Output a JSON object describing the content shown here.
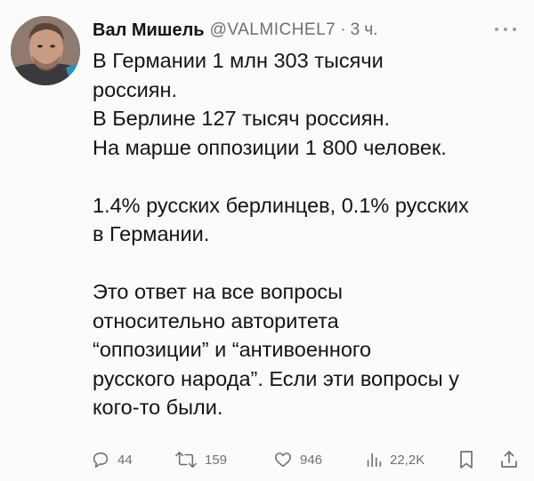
{
  "tweet": {
    "author_name": "Вал Мишель",
    "handle": "@VALMICHEL7",
    "separator": "·",
    "time": "3 ч.",
    "lines": [
      "В Германии 1 млн 303 тысячи",
      "россиян.",
      "В Берлине 127 тысяч россиян.",
      "На марше оппозиции 1 800 человек.",
      "",
      "1.4% русских берлинцев, 0.1% русских",
      "в Германии.",
      "",
      "Это ответ на все вопросы",
      "относительно авторитета",
      "“оппозиции” и “антивоенного",
      "русского народа”. Если эти вопросы у",
      "кого-то были."
    ]
  },
  "actions": {
    "replies": "44",
    "reposts": "159",
    "likes": "946",
    "views": "22,2K"
  },
  "icons": {
    "reply": "reply-icon",
    "repost": "repost-icon",
    "like": "heart-icon",
    "views": "views-icon",
    "bookmark": "bookmark-icon",
    "share": "share-icon",
    "more": "more-icon"
  },
  "colors": {
    "text": "#141414",
    "secondary": "#6b7177",
    "background": "#fbfbfa"
  }
}
